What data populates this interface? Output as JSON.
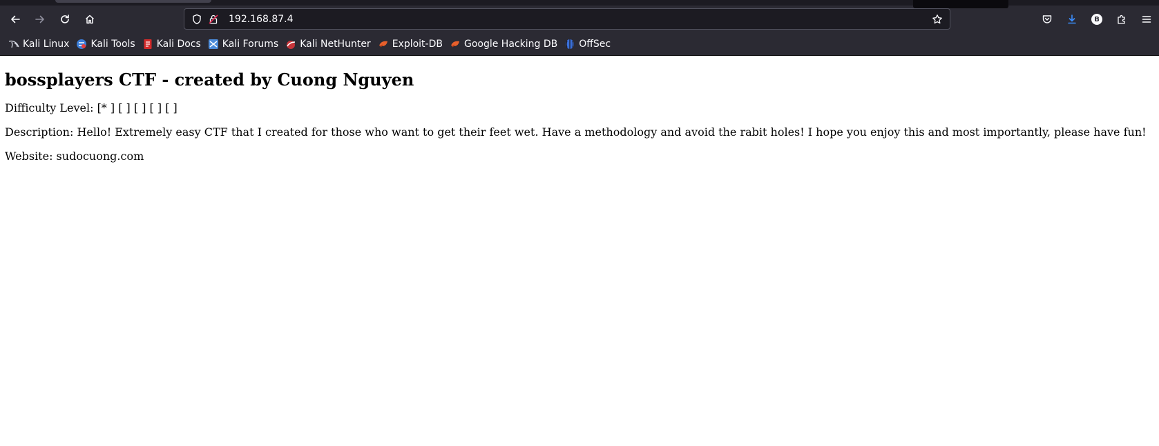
{
  "browser": {
    "url": "192.168.87.4"
  },
  "bookmarks": [
    {
      "label": "Kali Linux",
      "icon": "kali-dragon-icon"
    },
    {
      "label": "Kali Tools",
      "icon": "kali-tools-icon"
    },
    {
      "label": "Kali Docs",
      "icon": "kali-docs-icon"
    },
    {
      "label": "Kali Forums",
      "icon": "kali-forums-icon"
    },
    {
      "label": "Kali NetHunter",
      "icon": "kali-nethunter-icon"
    },
    {
      "label": "Exploit-DB",
      "icon": "exploit-db-icon"
    },
    {
      "label": "Google Hacking DB",
      "icon": "ghdb-icon"
    },
    {
      "label": "OffSec",
      "icon": "offsec-icon"
    }
  ],
  "toolbar": {
    "account_initial": "B"
  },
  "page": {
    "title": "bossplayers CTF - created by Cuong Nguyen",
    "difficulty": "Difficulty Level: [* ] [ ] [ ] [ ] [ ]",
    "description": "Description: Hello! Extremely easy CTF that I created for those who want to get their feet wet. Have a methodology and avoid the rabit holes! I hope you enjoy this and most importantly, please have fun!",
    "website": "Website: sudocuong.com"
  },
  "colors": {
    "chrome_bg": "#2b2a33",
    "urlbar_bg": "#1c1b22",
    "download_accent": "#3b8fff",
    "lock_warning": "#e22850"
  }
}
